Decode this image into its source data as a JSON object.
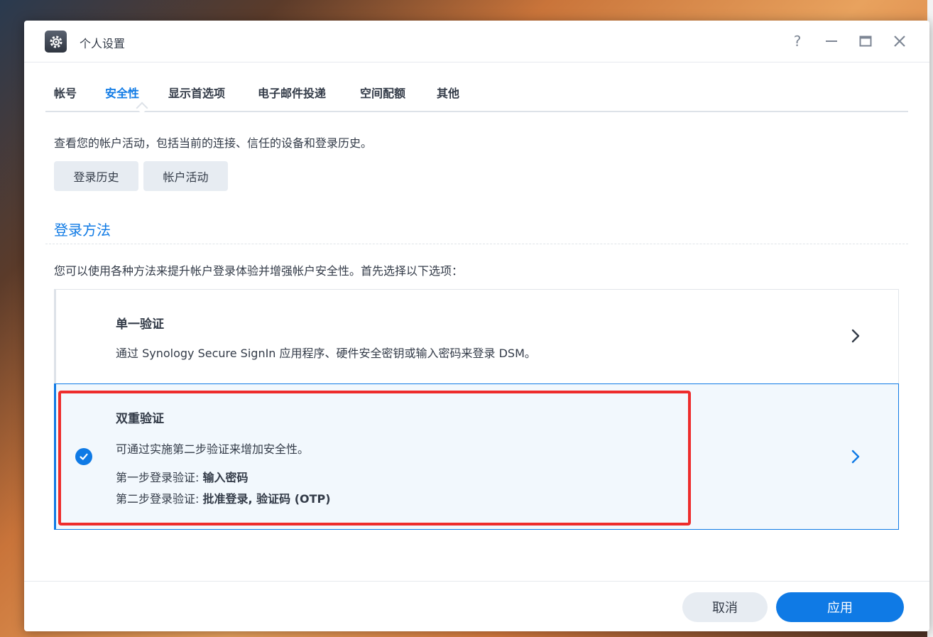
{
  "window": {
    "title": "个人设置",
    "help_glyph": "?"
  },
  "tabs": [
    {
      "label": "帐号"
    },
    {
      "label": "安全性"
    },
    {
      "label": "显示首选项"
    },
    {
      "label": "电子邮件投递"
    },
    {
      "label": "空间配额"
    },
    {
      "label": "其他"
    }
  ],
  "active_tab": "安全性",
  "activity": {
    "description": "查看您的帐户活动，包括当前的连接、信任的设备和登录历史。",
    "login_history_label": "登录历史",
    "account_activity_label": "帐户活动"
  },
  "login_method": {
    "title": "登录方法",
    "description": "您可以使用各种方法来提升帐户登录体验并增强帐户安全性。首先选择以下选项：",
    "options": [
      {
        "title": "单一验证",
        "description": "通过 Synology Secure SignIn 应用程序、硬件安全密钥或输入密码来登录 DSM。",
        "selected": false
      },
      {
        "title": "双重验证",
        "description": "可通过实施第二步验证来增加安全性。",
        "step1_label": "第一步登录验证: ",
        "step1_value": "输入密码",
        "step2_label": "第二步登录验证: ",
        "step2_value": "批准登录, 验证码 (OTP)",
        "selected": true
      }
    ]
  },
  "footer": {
    "cancel_label": "取消",
    "apply_label": "应用"
  },
  "colors": {
    "accent": "#0f7ae5",
    "highlight_box": "#ee2c2c",
    "text": "#333b48"
  }
}
